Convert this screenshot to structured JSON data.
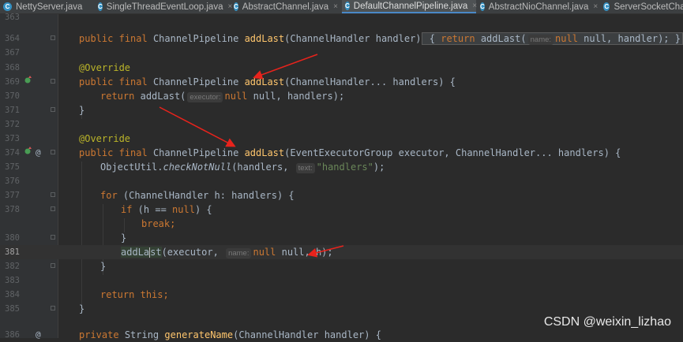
{
  "tabs": [
    {
      "label": "NettyServer.java",
      "icon": "class-icon",
      "active": false
    },
    {
      "label": "SingleThreadEventLoop.java",
      "icon": "class-icon",
      "active": false
    },
    {
      "label": "AbstractChannel.java",
      "icon": "class-icon",
      "active": false
    },
    {
      "label": "DefaultChannelPipeline.java",
      "icon": "class-icon",
      "active": true
    },
    {
      "label": "AbstractNioChannel.java",
      "icon": "class-icon",
      "active": false
    },
    {
      "label": "ServerSocketChan",
      "icon": "class-icon",
      "active": false
    }
  ],
  "tab_close_glyph": "×",
  "class_icon_letter": "C",
  "lines": {
    "l363": "363",
    "l364": "364",
    "l367": "367",
    "l368": "368",
    "l369": "369",
    "l370": "370",
    "l371": "371",
    "l372": "372",
    "l373": "373",
    "l374": "374",
    "l375": "375",
    "l376": "376",
    "l377": "377",
    "l378": "378",
    "l380": "380",
    "l381": "381",
    "l382": "382",
    "l383": "383",
    "l384": "384",
    "l385": "385",
    "l386": "386"
  },
  "tokens": {
    "public": "public",
    "final": "final",
    "return": "return",
    "for": "for",
    "if": "if",
    "null": "null",
    "break": "break;",
    "this": "this;",
    "private": "private",
    "override": "@Override",
    "channelPipeline": "ChannelPipeline",
    "addLast": "addLast",
    "sig364_params": "(ChannelHandler handler)",
    "sig364_open": " { ",
    "sig364_ret_open": "(",
    "hint_name": "name:",
    "sig364_ret_args": " null, handler);",
    "sig364_close": " }",
    "sig369_params": "(ChannelHandler... handlers) {",
    "l370_open": "addLast(",
    "hint_executor": "executor:",
    "l370_args": " null, handlers);",
    "close_brace": "}",
    "sig374_params": "(EventExecutorGroup executor, ChannelHandler... handlers) {",
    "l375_obj": "ObjectUtil.",
    "l375_method": "checkNotNull",
    "l375_args": "(handlers, ",
    "hint_text": "text:",
    "l375_str": "\"handlers\"",
    "l375_end": ");",
    "l377_rest": " (ChannelHandler h: handlers) {",
    "l378_open": " (h == ",
    "l378_close": ") {",
    "l381_a": "addLa",
    "l381_b": "st",
    "l381_args": "(executor, ",
    "l381_end": " null, h);",
    "l386_string": "String",
    "l386_method": "generateName",
    "l386_rest": "(ChannelHandler handler) {"
  },
  "gutter_icons": {
    "l369": "override-icon",
    "l374": "override-icon",
    "l374_at": "@",
    "l386_at": "@"
  },
  "watermark": "CSDN @weixin_lizhao",
  "colors": {
    "background": "#2b2b2b",
    "keyword": "#cc7832",
    "method": "#ffc66d",
    "annotation": "#bbb529",
    "string": "#6a8759",
    "arrow": "#e8231c"
  }
}
